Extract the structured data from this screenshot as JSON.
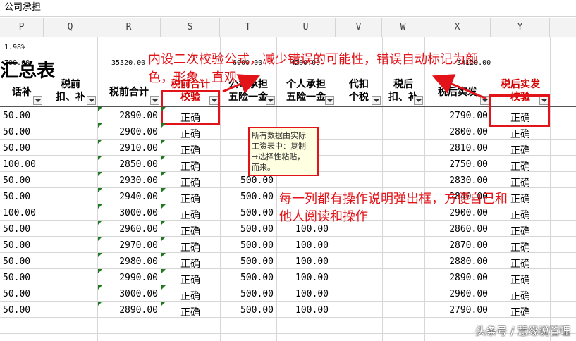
{
  "formula_bar": {
    "text": "公司承担"
  },
  "columns": [
    "P",
    "Q",
    "R",
    "S",
    "T",
    "U",
    "V",
    "W",
    "X",
    "Y"
  ],
  "top_cells": {
    "p_percent": "1.98%",
    "p_value": "700.00",
    "r_value": "35320.00",
    "t_value": "6000.00",
    "u_value": "4200.00",
    "x_value": "34120.00"
  },
  "title": "汇总表",
  "headers": {
    "p": "话补",
    "q_line1": "税前",
    "q_line2": "扣、补",
    "r": "税前合计",
    "s_line1": "税前合计",
    "s_line2": "校验",
    "t_line1": "公司承担",
    "t_line2": "五险一金",
    "u_line1": "个人承担",
    "u_line2": "五险一金",
    "v_line1": "代扣",
    "v_line2": "个税",
    "w_line1": "税后",
    "w_line2": "扣、补",
    "x": "税后实发",
    "y_line1": "税后实发",
    "y_line2": "校验"
  },
  "rows": [
    {
      "p": "50.00",
      "r": "2890.00",
      "s": "正确",
      "t": "",
      "u": "",
      "x": "2790.00",
      "y": "正确"
    },
    {
      "p": "50.00",
      "r": "2900.00",
      "s": "正确",
      "t": "",
      "u": "",
      "x": "2800.00",
      "y": "正确"
    },
    {
      "p": "50.00",
      "r": "2910.00",
      "s": "正确",
      "t": "",
      "u": "",
      "x": "2810.00",
      "y": "正确"
    },
    {
      "p": "100.00",
      "r": "2850.00",
      "s": "正确",
      "t": "",
      "u": "",
      "x": "2750.00",
      "y": "正确"
    },
    {
      "p": "50.00",
      "r": "2930.00",
      "s": "正确",
      "t": "500.00",
      "u": "",
      "x": "2830.00",
      "y": "正确"
    },
    {
      "p": "50.00",
      "r": "2940.00",
      "s": "正确",
      "t": "500.00",
      "u": "",
      "x": "2840.00",
      "y": "正确"
    },
    {
      "p": "100.00",
      "r": "3000.00",
      "s": "正确",
      "t": "500.00",
      "u": "",
      "x": "2900.00",
      "y": "正确"
    },
    {
      "p": "50.00",
      "r": "2960.00",
      "s": "正确",
      "t": "500.00",
      "u": "100.00",
      "x": "2860.00",
      "y": "正确"
    },
    {
      "p": "50.00",
      "r": "2970.00",
      "s": "正确",
      "t": "500.00",
      "u": "100.00",
      "x": "2870.00",
      "y": "正确"
    },
    {
      "p": "50.00",
      "r": "2980.00",
      "s": "正确",
      "t": "500.00",
      "u": "100.00",
      "x": "2880.00",
      "y": "正确"
    },
    {
      "p": "50.00",
      "r": "2990.00",
      "s": "正确",
      "t": "500.00",
      "u": "100.00",
      "x": "2890.00",
      "y": "正确"
    },
    {
      "p": "50.00",
      "r": "3000.00",
      "s": "正确",
      "t": "500.00",
      "u": "100.00",
      "x": "2900.00",
      "y": "正确"
    },
    {
      "p": "50.00",
      "r": "2890.00",
      "s": "正确",
      "t": "500.00",
      "u": "100.00",
      "x": "2790.00",
      "y": "正确"
    }
  ],
  "annotations": {
    "top_line1": "内设二次校验公式，减少错误的可能性，错误自动标记为颜",
    "top_line2": "色，形象、直观",
    "middle_line1": "每一列都有操作说明弹出框，方便自己和",
    "middle_line2": "他人阅读和操作"
  },
  "tooltip": {
    "line1": "所有数据由实际",
    "line2": "工资表中：复制",
    "line3": "→选择性粘贴，",
    "line4": "而来。"
  },
  "watermark": "头条号 / 慧缘说管理",
  "colors": {
    "annotation_red": "#e2141a",
    "tooltip_bg": "#ffffe1",
    "grid": "#d6d6d6"
  }
}
